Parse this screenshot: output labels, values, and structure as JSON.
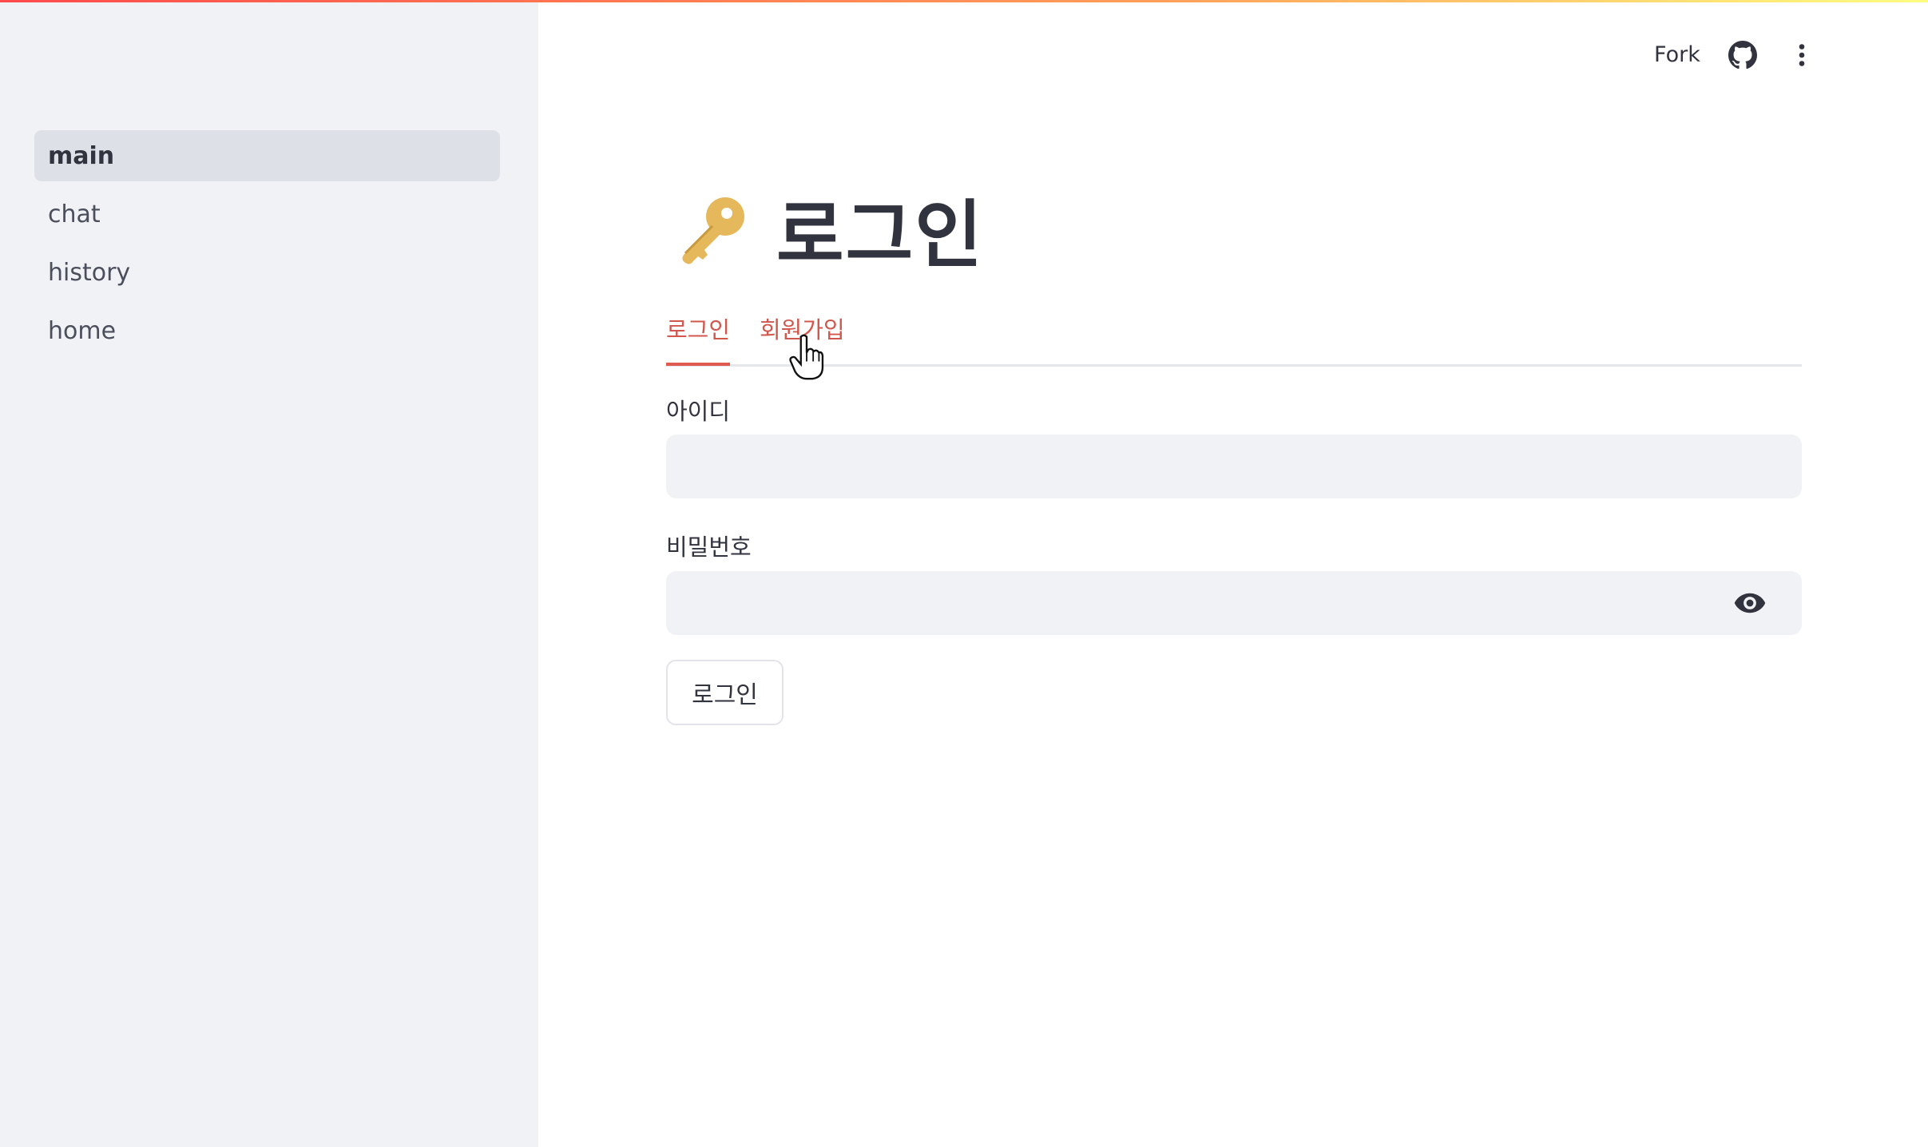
{
  "sidebar": {
    "items": [
      {
        "label": "main",
        "active": true
      },
      {
        "label": "chat",
        "active": false
      },
      {
        "label": "history",
        "active": false
      },
      {
        "label": "home",
        "active": false
      }
    ]
  },
  "header": {
    "fork_label": "Fork",
    "icons": [
      "github-icon",
      "more-vertical-icon"
    ]
  },
  "main": {
    "title_icon": "key-icon",
    "title": "로그인",
    "tabs": [
      {
        "label": "로그인",
        "selected": true
      },
      {
        "label": "회원가입",
        "selected": false
      }
    ],
    "form": {
      "username_label": "아이디",
      "username_value": "",
      "password_label": "비밀번호",
      "password_value": "",
      "password_toggle_icon": "eye-icon",
      "submit_label": "로그인"
    }
  },
  "colors": {
    "accent": "#e05a4f",
    "sidebar_bg": "#f0f2f6",
    "input_bg": "#f0f2f6",
    "active_nav_bg": "#dee0e7",
    "text": "#31333f",
    "key_gold": "#e5b85c"
  }
}
